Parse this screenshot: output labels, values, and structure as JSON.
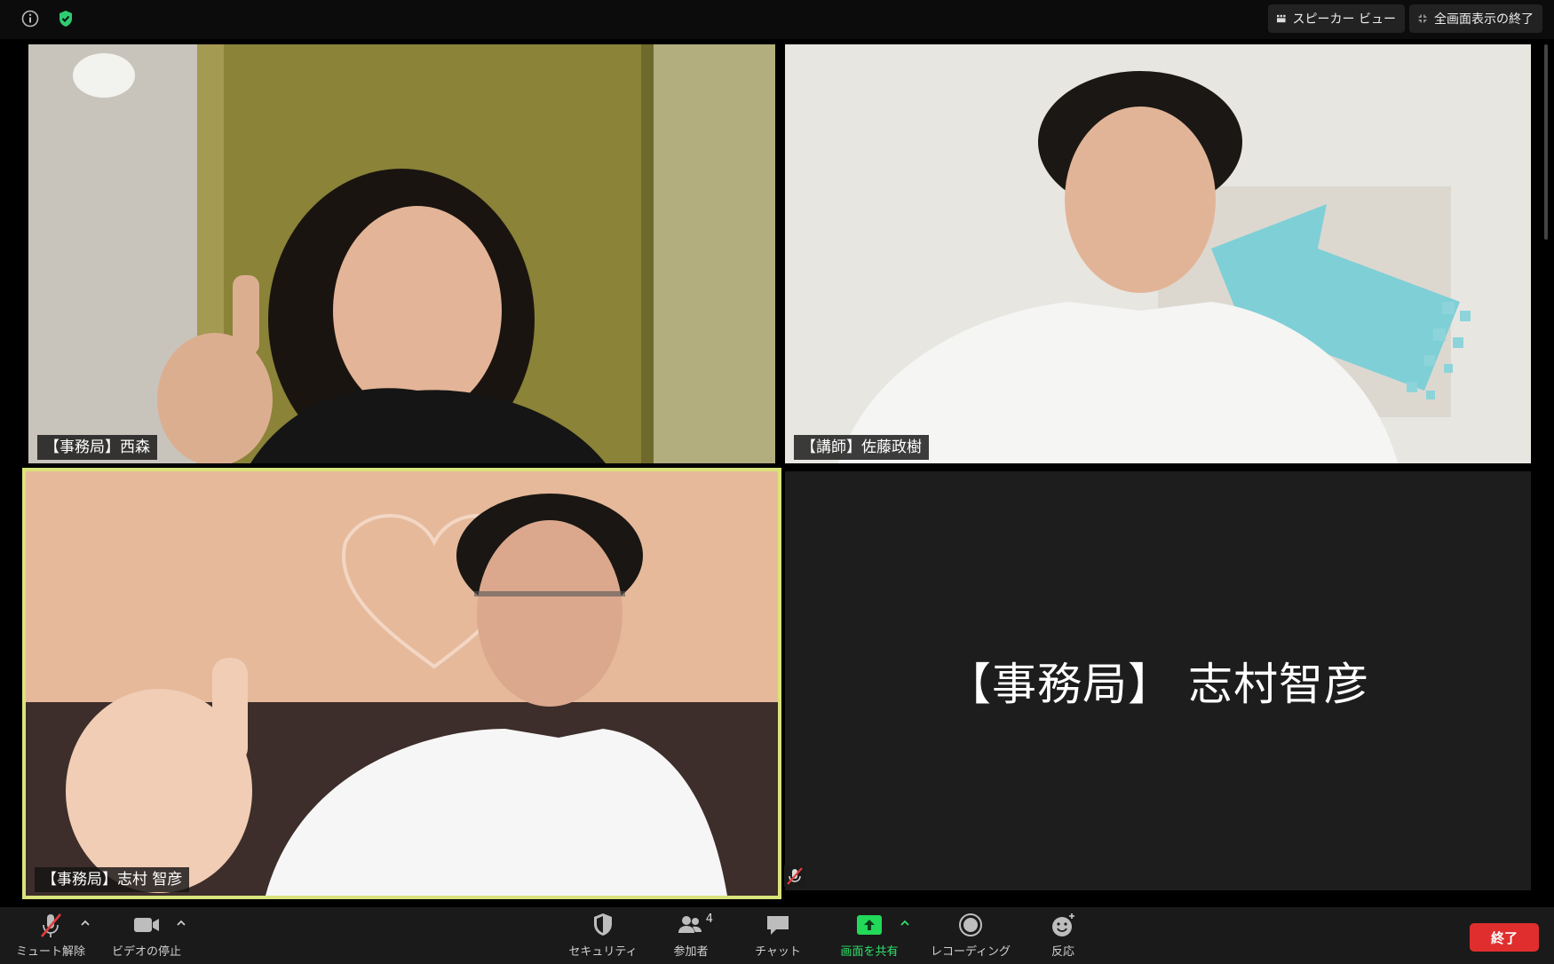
{
  "topbar": {
    "speaker_view_label": "スピーカー ビュー",
    "exit_fullscreen_label": "全画面表示の終了"
  },
  "participants": [
    {
      "name": "【事務局】西森"
    },
    {
      "name": "【講師】佐藤政樹"
    },
    {
      "name": "【事務局】志村 智彦"
    },
    {
      "name": "【事務局】 志村智彦"
    }
  ],
  "toolbar": {
    "mute_label": "ミュート解除",
    "video_label": "ビデオの停止",
    "security_label": "セキュリティ",
    "participants_label": "参加者",
    "participants_count": "4",
    "chat_label": "チャット",
    "share_label": "画面を共有",
    "record_label": "レコーディング",
    "reactions_label": "反応",
    "end_label": "終了"
  },
  "colors": {
    "active_speaker_border": "#d9e37a",
    "share_green": "#23d959",
    "end_red": "#e02e2e",
    "shield_green": "#2ecc71"
  }
}
